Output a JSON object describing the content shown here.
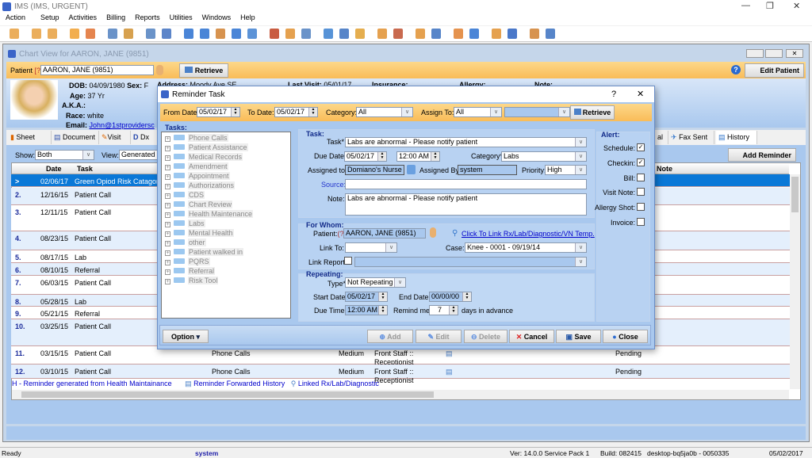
{
  "app": {
    "title": "IMS (IMS, URGENT)",
    "menu": [
      "Action",
      "Setup",
      "Activities",
      "Billing",
      "Reports",
      "Utilities",
      "Windows",
      "Help"
    ]
  },
  "chart": {
    "title": "Chart View for AARON, JANE  (9851)",
    "patient_label": "Patient",
    "help_mark": "[?]",
    "patient_value": "AARON, JANE  (9851)",
    "retrieve": "Retrieve",
    "edit_patient": "Edit Patient",
    "info": {
      "dob_l": "DOB:",
      "dob": "04/09/1980",
      "sex_l": "Sex:",
      "sex": "F",
      "age_l": "Age:",
      "age": "37 Yr",
      "aka_l": "A.K.A.:",
      "race_l": "Race:",
      "race": "white",
      "email_l": "Email:",
      "email": "John@1stprovidersc",
      "address_l": "Address:",
      "address": "Moody Ave SE",
      "lastvisit_l": "Last Visit:",
      "lastvisit": "05/01/17",
      "insurance_l": "Insurance:",
      "allergy_l": "Allergy:",
      "note_l": "Note:"
    },
    "tabs": [
      "Sheet",
      "Document",
      "Visit",
      "Dx",
      "al",
      "Fax Sent",
      "History"
    ],
    "show_label": "Show:",
    "show_value": "Both",
    "view_label": "View:",
    "view_value": "Generated T",
    "add_reminder": "Add Reminder",
    "columns": {
      "date": "Date",
      "task": "Task",
      "note": "Note"
    },
    "rows": [
      {
        "n": ">",
        "date": "02/06/17",
        "task": "Green Opiod Risk Catagory"
      },
      {
        "n": "2.",
        "date": "12/16/15",
        "task": "Patient Call"
      },
      {
        "n": "3.",
        "date": "12/11/15",
        "task": "Patient Call"
      },
      {
        "n": "4.",
        "date": "08/23/15",
        "task": "Patient Call"
      },
      {
        "n": "5.",
        "date": "08/17/15",
        "task": "Lab"
      },
      {
        "n": "6.",
        "date": "08/10/15",
        "task": "Referral"
      },
      {
        "n": "7.",
        "date": "06/03/15",
        "task": "Patient Call"
      },
      {
        "n": "8.",
        "date": "05/28/15",
        "task": "Lab"
      },
      {
        "n": "9.",
        "date": "05/21/15",
        "task": "Referral"
      },
      {
        "n": "10.",
        "date": "03/25/15",
        "task": "Patient Call"
      },
      {
        "n": "11.",
        "date": "03/15/15",
        "task": "Patient Call",
        "cat": "Phone Calls",
        "pri": "Medium",
        "to": "Front Staff ::",
        "to2": "Receptionist",
        "status": "Pending"
      },
      {
        "n": "12.",
        "date": "03/10/15",
        "task": "Patient Call",
        "cat": "Phone Calls",
        "pri": "Medium",
        "to": "Front Staff ::",
        "to2": "Receptionist",
        "status": "Pending"
      }
    ],
    "legend": {
      "h": "H -  Reminder generated from Health Maintainance",
      "fwd": "Reminder Forwarded History",
      "linked": "Linked Rx/Lab/Diagnostic"
    }
  },
  "dialog": {
    "title": "Reminder Task",
    "help": "?",
    "close": "✕",
    "filter": {
      "from_l": "From Date:",
      "from": "05/02/17",
      "to_l": "To Date:",
      "to": "05/02/17",
      "cat_l": "Category:",
      "cat": "All",
      "assign_l": "Assign To:",
      "assign": "All",
      "retrieve": "Retrieve"
    },
    "tasks_label": "Tasks:",
    "tree": [
      "Phone Calls",
      "Patient Assistance",
      "Medical Records",
      "Amendment",
      "Appointment",
      "Authorizations",
      "CDS",
      "Chart Review",
      "Health Maintenance",
      "Labs",
      "Mental Health",
      "other",
      "Patient walked in",
      "PQRS",
      "Referral",
      "Risk Tool"
    ],
    "task": {
      "group": "Task:",
      "task_l": "Task*",
      "task": "Labs are abnormal - Please notify patient",
      "due_l": "Due Date*",
      "due": "05/02/17",
      "time": "12:00 AM",
      "cat_l": "Category*",
      "cat": "Labs",
      "assigned_l": "Assigned to*",
      "assigned": "Domiano's Nurse",
      "by_l": "Assigned By:",
      "by": "system",
      "pri_l": "Priority:",
      "pri": "High",
      "source_l": "Source:",
      "source": "",
      "note_l": "Note:",
      "note": "Labs are abnormal - Please notify patient"
    },
    "whom": {
      "group": "For Whom:",
      "patient_l": "Patient:",
      "q": "(?)",
      "patient": "AARON, JANE  (9851)",
      "link_text": "Click To Link Rx/Lab/Diagnostic/VN Temp.",
      "linkto_l": "Link To:",
      "case_l": "Case:",
      "case": "Knee   -  0001 - 09/19/14",
      "report_l": "Link Report:"
    },
    "repeat": {
      "group": "Repeating:",
      "type_l": "Type*",
      "type": "Not Repeating",
      "start_l": "Start Date*",
      "start": "05/02/17",
      "end_l": "End Date:",
      "end": "00/00/00",
      "time_l": "Due Time:",
      "time": "12:00 AM",
      "remind_l": "Remind me:",
      "remind": "7",
      "days": "days in advance"
    },
    "alert": {
      "group": "Alert:",
      "items": [
        {
          "label": "Schedule:",
          "checked": true
        },
        {
          "label": "Checkin:",
          "checked": true
        },
        {
          "label": "Bill:",
          "checked": false
        },
        {
          "label": "Visit Note:",
          "checked": false
        },
        {
          "label": "Allergy Shot:",
          "checked": false
        },
        {
          "label": "Invoice:",
          "checked": false
        }
      ]
    },
    "buttons": {
      "option": "Option",
      "add": "Add",
      "edit": "Edit",
      "delete": "Delete",
      "cancel": "Cancel",
      "save": "Save",
      "close": "Close"
    }
  },
  "status": {
    "ready": "Ready",
    "user": "system",
    "ver": "Ver: 14.0.0 Service Pack 1",
    "build": "Build: 082415",
    "machine": "desktop-bq5ja0b - 0050335",
    "date": "05/02/2017"
  },
  "colors": {
    "orange": "#fbc86a",
    "blue": "#a9c8ee",
    "select": "#0a78d7",
    "label_blue": "#102a8a"
  }
}
